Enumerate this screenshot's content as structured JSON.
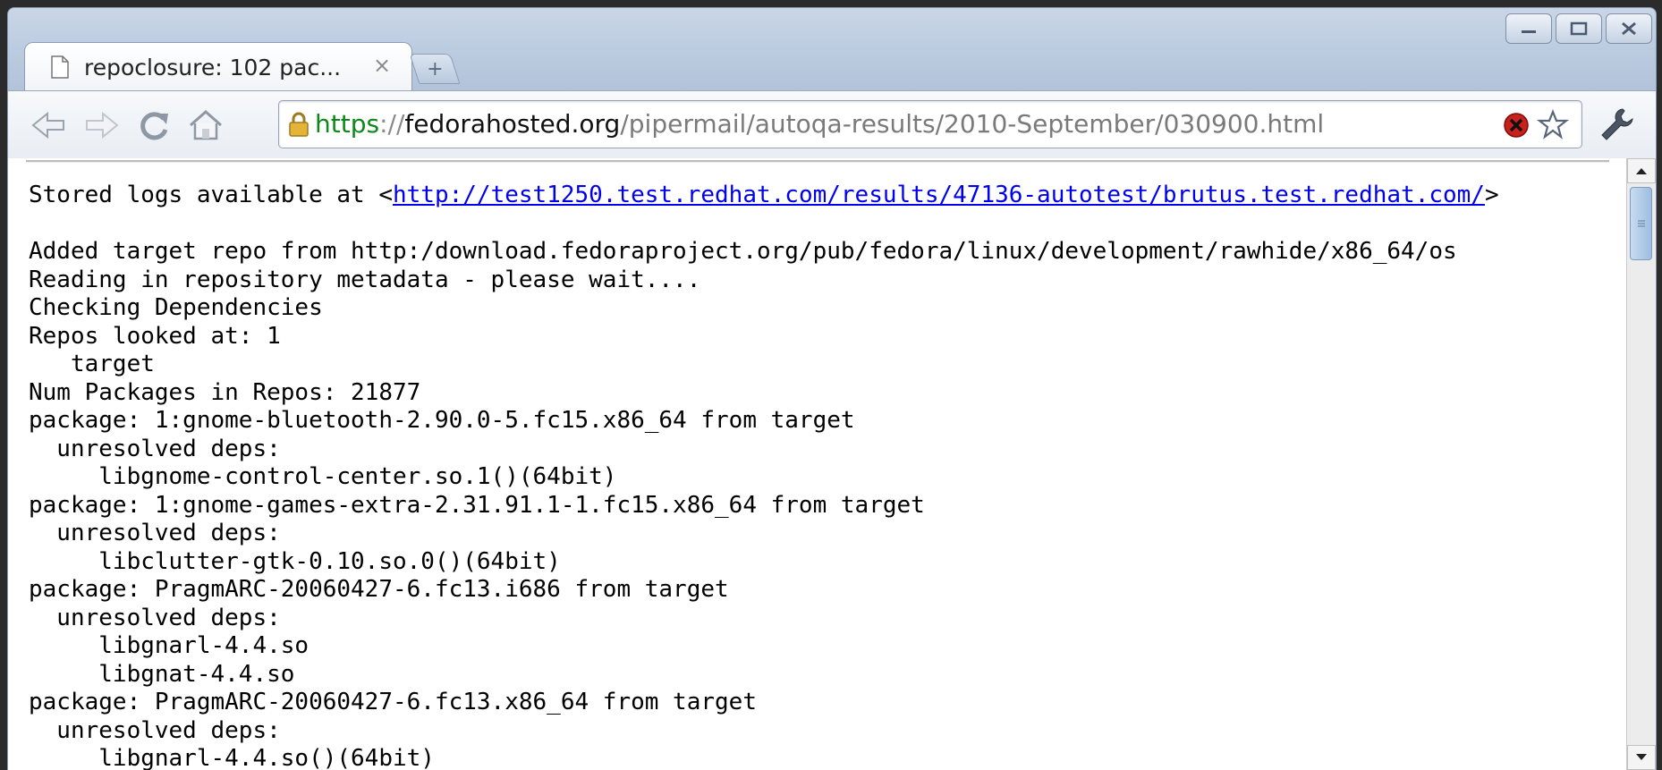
{
  "tab": {
    "title": "repoclosure: 102 pac...",
    "close_glyph": "×",
    "new_tab_glyph": "+"
  },
  "omnibox": {
    "scheme": "https",
    "separator": "://",
    "host": "fedorahosted.org",
    "path": "/pipermail/autoqa-results/2010-September/030900.html"
  },
  "log": {
    "prefix": "Stored logs available at <",
    "link": "http://test1250.test.redhat.com/results/47136-autotest/brutus.test.redhat.com/",
    "suffix": ">",
    "body": "Added target repo from http:/download.fedoraproject.org/pub/fedora/linux/development/rawhide/x86_64/os\nReading in repository metadata - please wait....\nChecking Dependencies\nRepos looked at: 1\n   target\nNum Packages in Repos: 21877\npackage: 1:gnome-bluetooth-2.90.0-5.fc15.x86_64 from target\n  unresolved deps:\n     libgnome-control-center.so.1()(64bit)\npackage: 1:gnome-games-extra-2.31.91.1-1.fc15.x86_64 from target\n  unresolved deps:\n     libclutter-gtk-0.10.so.0()(64bit)\npackage: PragmARC-20060427-6.fc13.i686 from target\n  unresolved deps:\n     libgnarl-4.4.so\n     libgnat-4.4.so\npackage: PragmARC-20060427-6.fc13.x86_64 from target\n  unresolved deps:\n     libgnarl-4.4.so()(64bit)"
  },
  "colors": {
    "secure_scheme": "#0b8a1a",
    "link": "#0000ee",
    "chrome_frame": "#b8c9de"
  },
  "icons": [
    "page-favicon-icon",
    "close-icon",
    "new-tab-icon",
    "back-icon",
    "forward-icon",
    "reload-icon",
    "home-icon",
    "lock-icon",
    "blocked-content-icon",
    "bookmark-star-icon",
    "wrench-icon",
    "minimize-icon",
    "maximize-icon",
    "window-close-icon"
  ]
}
